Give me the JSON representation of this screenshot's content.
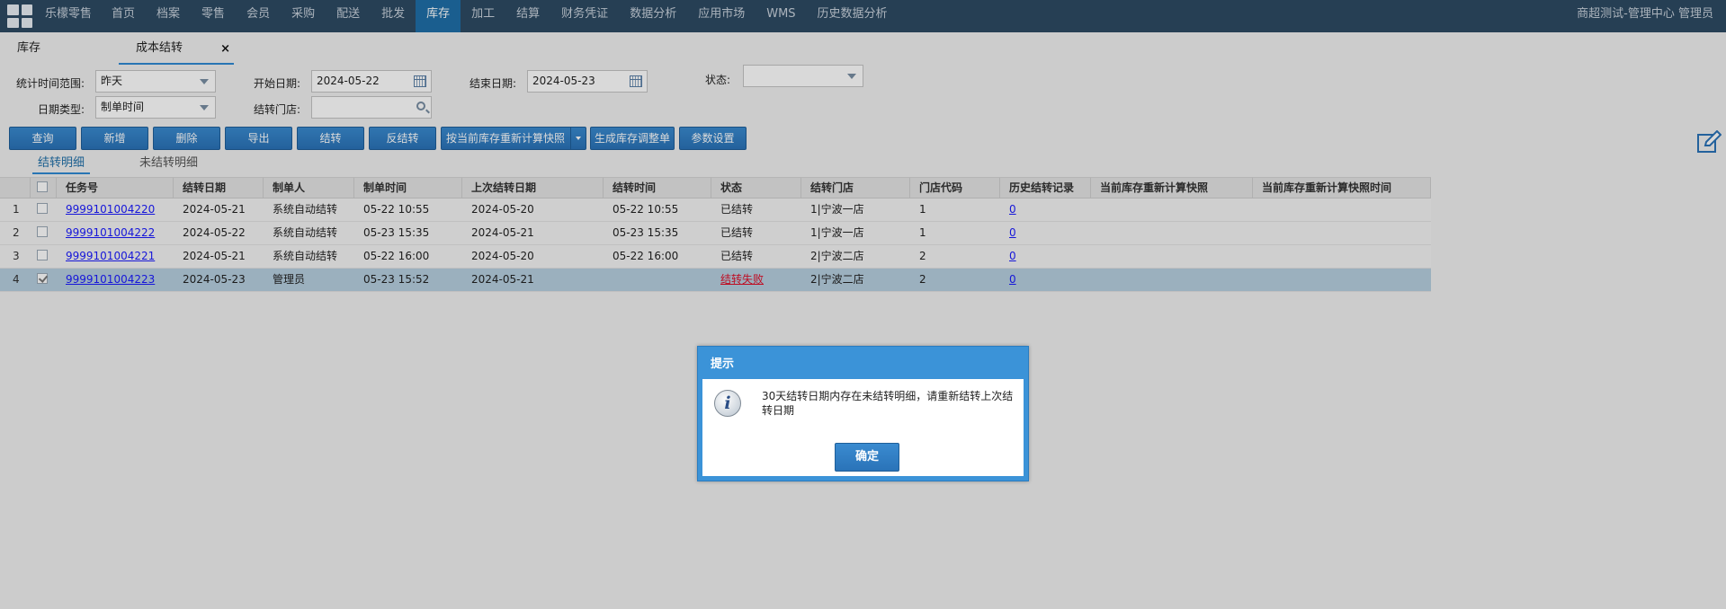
{
  "nav": {
    "brand": "乐檬零售",
    "items": [
      "首页",
      "档案",
      "零售",
      "会员",
      "采购",
      "配送",
      "批发",
      "库存",
      "加工",
      "结算",
      "财务凭证",
      "数据分析",
      "应用市场",
      "WMS",
      "历史数据分析"
    ],
    "active": "库存",
    "user": "商超测试-管理中心 管理员"
  },
  "tabs": {
    "tab1": "库存",
    "tab2": "成本结转",
    "close": "×"
  },
  "filters": {
    "range_label": "统计时间范围:",
    "range_value": "昨天",
    "start_label": "开始日期:",
    "start_value": "2024-05-22",
    "end_label": "结束日期:",
    "end_value": "2024-05-23",
    "status_label": "状态:",
    "status_value": "",
    "datetype_label": "日期类型:",
    "datetype_value": "制单时间",
    "store_label": "结转门店:",
    "store_value": ""
  },
  "toolbar": {
    "query": "查询",
    "add": "新增",
    "delete": "删除",
    "export": "导出",
    "transfer": "结转",
    "reverse": "反结转",
    "snapshot": "按当前库存重新计算快照",
    "adjust": "生成库存调整单",
    "settings": "参数设置"
  },
  "subtabs": {
    "detail": "结转明细",
    "pending": "未结转明细"
  },
  "table": {
    "headers": {
      "task": "任务号",
      "date": "结转日期",
      "maker": "制单人",
      "mtime": "制单时间",
      "last": "上次结转日期",
      "ctime": "结转时间",
      "status": "状态",
      "store": "结转门店",
      "code": "门店代码",
      "hist": "历史结转记录",
      "snap": "当前库存重新计算快照",
      "snapt": "当前库存重新计算快照时间"
    },
    "rows": [
      {
        "n": "1",
        "task": "9999101004220",
        "date": "2024-05-21",
        "maker": "系统自动结转",
        "mtime": "05-22 10:55",
        "last": "2024-05-20",
        "ctime": "05-22 10:55",
        "status": "已结转",
        "store": "1|宁波一店",
        "code": "1",
        "hist": "0",
        "snap": "",
        "snapt": ""
      },
      {
        "n": "2",
        "task": "9999101004222",
        "date": "2024-05-22",
        "maker": "系统自动结转",
        "mtime": "05-23 15:35",
        "last": "2024-05-21",
        "ctime": "05-23 15:35",
        "status": "已结转",
        "store": "1|宁波一店",
        "code": "1",
        "hist": "0",
        "snap": "",
        "snapt": ""
      },
      {
        "n": "3",
        "task": "9999101004221",
        "date": "2024-05-21",
        "maker": "系统自动结转",
        "mtime": "05-22 16:00",
        "last": "2024-05-20",
        "ctime": "05-22 16:00",
        "status": "已结转",
        "store": "2|宁波二店",
        "code": "2",
        "hist": "0",
        "snap": "",
        "snapt": ""
      },
      {
        "n": "4",
        "task": "9999101004223",
        "date": "2024-05-23",
        "maker": "管理员",
        "mtime": "05-23 15:52",
        "last": "2024-05-21",
        "ctime": "",
        "status": "结转失败",
        "store": "2|宁波二店",
        "code": "2",
        "hist": "0",
        "snap": "",
        "snapt": ""
      }
    ]
  },
  "dialog": {
    "title": "提示",
    "icon": "i",
    "message": "30天结转日期内存在未结转明细，请重新结转上次结转日期",
    "ok": "确定"
  }
}
